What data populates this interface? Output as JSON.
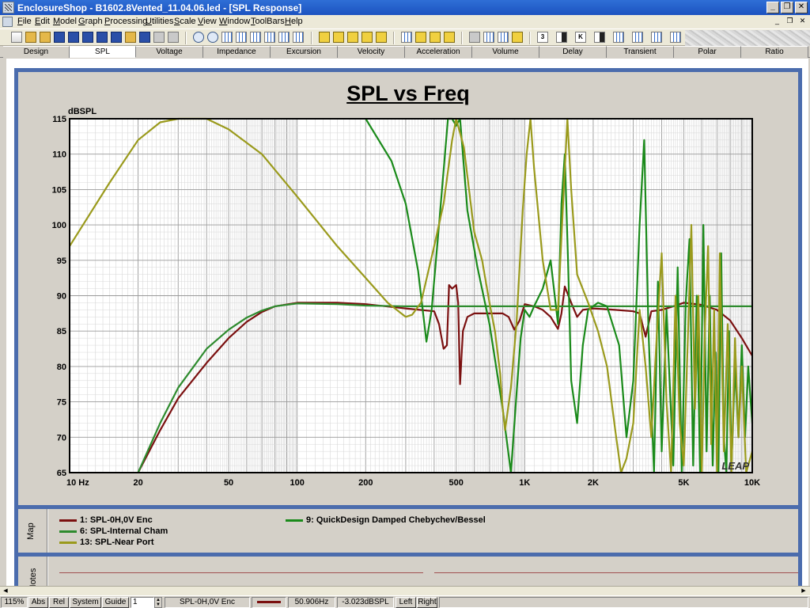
{
  "window": {
    "title": "EnclosureShop - B1602.8Vented_11.04.06.led - [SPL Response]",
    "min_glyph": "_",
    "max_glyph": "❐",
    "close_glyph": "✕"
  },
  "menu": {
    "items": [
      "File",
      "Edit",
      "Model",
      "Graph",
      "Processing",
      "Utilities",
      "Scale",
      "View",
      "Window",
      "ToolBars",
      "Help"
    ],
    "mdi_min": "_",
    "mdi_restore": "❐",
    "mdi_close": "✕"
  },
  "toolbar": {
    "text_buttons": [
      "3",
      "K"
    ]
  },
  "tabs": {
    "items": [
      "Design",
      "SPL",
      "Voltage",
      "Impedance",
      "Excursion",
      "Velocity",
      "Acceleration",
      "Volume",
      "Delay",
      "Transient",
      "Polar",
      "Ratio"
    ],
    "active": "SPL"
  },
  "chart_data": {
    "type": "line",
    "title": "SPL vs Freq",
    "ylabel": "dBSPL",
    "xlabel": "",
    "xscale": "log",
    "xlim": [
      10,
      10000
    ],
    "ylim": [
      65,
      115
    ],
    "xticks": [
      {
        "value": 10,
        "label": "10  Hz"
      },
      {
        "value": 20,
        "label": "20"
      },
      {
        "value": 50,
        "label": "50"
      },
      {
        "value": 100,
        "label": "100"
      },
      {
        "value": 200,
        "label": "200"
      },
      {
        "value": 500,
        "label": "500"
      },
      {
        "value": 1000,
        "label": "1K"
      },
      {
        "value": 2000,
        "label": "2K"
      },
      {
        "value": 5000,
        "label": "5K"
      },
      {
        "value": 10000,
        "label": "10K"
      }
    ],
    "yticks": [
      115,
      110,
      105,
      100,
      95,
      90,
      85,
      80,
      75,
      70,
      65
    ],
    "grid": true,
    "watermark": "LEAP",
    "series": [
      {
        "name": "1: SPL-0H,0V Enc",
        "color": "#7b1010",
        "points": [
          [
            20,
            65
          ],
          [
            25,
            71
          ],
          [
            30,
            75.5
          ],
          [
            40,
            80.5
          ],
          [
            50,
            84
          ],
          [
            60,
            86.3
          ],
          [
            70,
            87.7
          ],
          [
            80,
            88.5
          ],
          [
            100,
            89
          ],
          [
            150,
            89
          ],
          [
            200,
            88.8
          ],
          [
            300,
            88.2
          ],
          [
            400,
            87.8
          ],
          [
            420,
            86
          ],
          [
            440,
            82.5
          ],
          [
            455,
            83
          ],
          [
            465,
            91.5
          ],
          [
            480,
            91
          ],
          [
            500,
            91.5
          ],
          [
            510,
            89
          ],
          [
            520,
            77.5
          ],
          [
            535,
            85
          ],
          [
            560,
            87
          ],
          [
            600,
            87.5
          ],
          [
            700,
            87.5
          ],
          [
            800,
            87.5
          ],
          [
            850,
            87
          ],
          [
            900,
            85.2
          ],
          [
            950,
            86.5
          ],
          [
            1000,
            88.8
          ],
          [
            1100,
            88.5
          ],
          [
            1200,
            88
          ],
          [
            1300,
            87
          ],
          [
            1400,
            85.3
          ],
          [
            1450,
            87.5
          ],
          [
            1500,
            91.3
          ],
          [
            1600,
            89
          ],
          [
            1700,
            87
          ],
          [
            1800,
            88
          ],
          [
            2000,
            88.2
          ],
          [
            2500,
            88
          ],
          [
            3000,
            87.8
          ],
          [
            3200,
            87.5
          ],
          [
            3400,
            84.2
          ],
          [
            3600,
            87.8
          ],
          [
            4000,
            88
          ],
          [
            4500,
            88.5
          ],
          [
            5000,
            89
          ],
          [
            6000,
            88.7
          ],
          [
            7000,
            88
          ],
          [
            8000,
            86.5
          ],
          [
            9000,
            84
          ],
          [
            10000,
            81.5
          ]
        ]
      },
      {
        "name": "6: SPL-Internal Cham",
        "color": "#2e8b2e",
        "points": [
          [
            20,
            65
          ],
          [
            25,
            72
          ],
          [
            30,
            77
          ],
          [
            40,
            82.5
          ],
          [
            50,
            85.2
          ],
          [
            60,
            86.9
          ],
          [
            70,
            87.9
          ],
          [
            80,
            88.5
          ],
          [
            100,
            88.9
          ],
          [
            150,
            88.8
          ],
          [
            200,
            88.6
          ],
          [
            300,
            88.5
          ],
          [
            10000,
            88.5
          ]
        ]
      },
      {
        "name": "9: QuickDesign Damped Chebychev/Bessel",
        "color": "#1a8a1a",
        "points": [
          [
            200,
            115
          ],
          [
            260,
            109
          ],
          [
            300,
            103
          ],
          [
            340,
            93.5
          ],
          [
            370,
            83.5
          ],
          [
            390,
            88
          ],
          [
            420,
            100
          ],
          [
            460,
            115
          ],
          [
            480,
            115
          ],
          [
            500,
            114
          ],
          [
            520,
            115
          ],
          [
            560,
            102
          ],
          [
            620,
            94
          ],
          [
            700,
            86
          ],
          [
            800,
            74
          ],
          [
            870,
            65
          ],
          [
            920,
            76
          ],
          [
            960,
            84
          ],
          [
            1000,
            88
          ],
          [
            1050,
            87
          ],
          [
            1100,
            88.5
          ],
          [
            1200,
            91
          ],
          [
            1300,
            95
          ],
          [
            1400,
            86
          ],
          [
            1450,
            103
          ],
          [
            1500,
            110
          ],
          [
            1550,
            95
          ],
          [
            1600,
            78
          ],
          [
            1700,
            72
          ],
          [
            1800,
            83
          ],
          [
            1900,
            88
          ],
          [
            2100,
            89
          ],
          [
            2300,
            88.5
          ],
          [
            2600,
            83
          ],
          [
            2800,
            70
          ],
          [
            3000,
            78
          ],
          [
            3200,
            100
          ],
          [
            3350,
            112
          ],
          [
            3500,
            85
          ],
          [
            3700,
            65
          ],
          [
            3850,
            92
          ],
          [
            4000,
            68
          ],
          [
            4200,
            88
          ],
          [
            4500,
            66
          ],
          [
            4700,
            94
          ],
          [
            4900,
            65
          ],
          [
            5100,
            89
          ],
          [
            5300,
            98
          ],
          [
            5500,
            66
          ],
          [
            5700,
            90
          ],
          [
            5900,
            65
          ],
          [
            6100,
            100
          ],
          [
            6300,
            68
          ],
          [
            6500,
            90
          ],
          [
            6700,
            66
          ],
          [
            6900,
            82
          ],
          [
            7100,
            65
          ],
          [
            7300,
            96
          ],
          [
            7500,
            70
          ],
          [
            7700,
            65
          ],
          [
            7900,
            85
          ],
          [
            8100,
            66
          ],
          [
            8400,
            80
          ],
          [
            8700,
            70
          ],
          [
            9000,
            83
          ],
          [
            9300,
            70
          ],
          [
            9600,
            80
          ],
          [
            10000,
            72
          ]
        ]
      },
      {
        "name": "13: SPL-Near Port",
        "color": "#9a9a1c",
        "points": [
          [
            10,
            97
          ],
          [
            15,
            106
          ],
          [
            20,
            112
          ],
          [
            25,
            114.5
          ],
          [
            30,
            115
          ],
          [
            40,
            115
          ],
          [
            50,
            113.5
          ],
          [
            70,
            110
          ],
          [
            100,
            104
          ],
          [
            150,
            97
          ],
          [
            200,
            92.5
          ],
          [
            250,
            89
          ],
          [
            300,
            87
          ],
          [
            320,
            87.3
          ],
          [
            350,
            89
          ],
          [
            400,
            97
          ],
          [
            440,
            103
          ],
          [
            480,
            112
          ],
          [
            500,
            115
          ],
          [
            540,
            111
          ],
          [
            600,
            99
          ],
          [
            650,
            95
          ],
          [
            700,
            89
          ],
          [
            740,
            85
          ],
          [
            780,
            79
          ],
          [
            800,
            74
          ],
          [
            820,
            71
          ],
          [
            870,
            77
          ],
          [
            920,
            86
          ],
          [
            980,
            102
          ],
          [
            1020,
            110
          ],
          [
            1060,
            115
          ],
          [
            1100,
            108
          ],
          [
            1200,
            95
          ],
          [
            1300,
            88
          ],
          [
            1400,
            88
          ],
          [
            1480,
            104
          ],
          [
            1540,
            115
          ],
          [
            1600,
            105
          ],
          [
            1700,
            93
          ],
          [
            1900,
            89
          ],
          [
            2100,
            85
          ],
          [
            2300,
            80
          ],
          [
            2500,
            71
          ],
          [
            2650,
            65
          ],
          [
            2800,
            67
          ],
          [
            3000,
            72
          ],
          [
            3200,
            88
          ],
          [
            3400,
            80
          ],
          [
            3600,
            70
          ],
          [
            3800,
            84
          ],
          [
            4000,
            96
          ],
          [
            4200,
            75
          ],
          [
            4400,
            65
          ],
          [
            4600,
            90
          ],
          [
            4800,
            72
          ],
          [
            5000,
            66
          ],
          [
            5200,
            83
          ],
          [
            5400,
            100
          ],
          [
            5600,
            74
          ],
          [
            5800,
            90
          ],
          [
            6000,
            65
          ],
          [
            6200,
            86
          ],
          [
            6400,
            97
          ],
          [
            6600,
            69
          ],
          [
            6800,
            88
          ],
          [
            7000,
            65
          ],
          [
            7200,
            96
          ],
          [
            7500,
            68
          ],
          [
            7800,
            86
          ],
          [
            8100,
            65
          ],
          [
            8400,
            84
          ],
          [
            8700,
            70
          ],
          [
            9000,
            80
          ],
          [
            9400,
            65
          ],
          [
            10000,
            68
          ]
        ]
      }
    ]
  },
  "panels": {
    "map_label": "Map",
    "notes_label": "Notes"
  },
  "statusbar": {
    "zoom": "115%",
    "abs": "Abs",
    "rel": "Rel",
    "system": "System",
    "guide": "Guide",
    "guide_value": "1",
    "curve_name": "SPL-0H,0V Enc",
    "curve_color": "#7b1010",
    "freq": "50.906Hz",
    "level": "-3.023dBSPL",
    "left": "Left",
    "right": "Right"
  }
}
